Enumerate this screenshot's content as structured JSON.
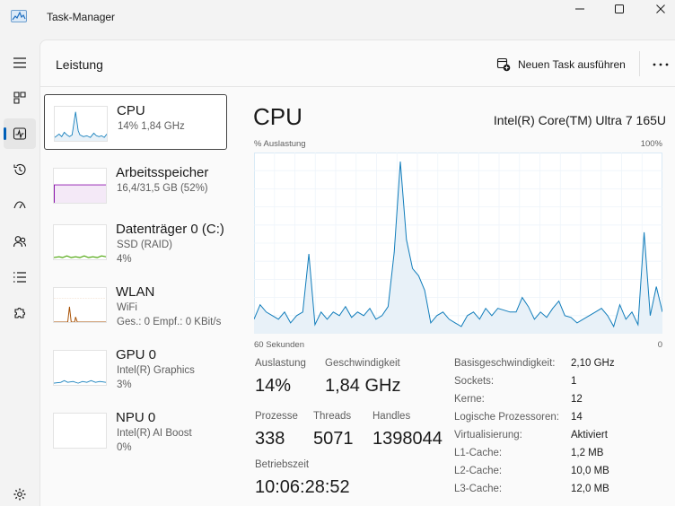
{
  "app": {
    "title": "Task-Manager"
  },
  "header": {
    "title": "Leistung",
    "new_task_label": "Neuen Task ausführen"
  },
  "perf_items": [
    {
      "name": "CPU",
      "sub": "14%  1,84 GHz",
      "color": "#117dbb"
    },
    {
      "name": "Arbeitsspeicher",
      "sub": "16,4/31,5 GB (52%)",
      "color": "#8b12ae"
    },
    {
      "name": "Datenträger 0 (C:)",
      "sub1": "SSD (RAID)",
      "sub2": "4%",
      "color": "#4da60c"
    },
    {
      "name": "WLAN",
      "sub1": "WiFi",
      "sub2": "Ges.: 0  Empf.: 0 KBit/s",
      "color": "#a74f01"
    },
    {
      "name": "GPU 0",
      "sub1": "Intel(R) Graphics",
      "sub2": "3%",
      "color": "#117dbb"
    },
    {
      "name": "NPU 0",
      "sub1": "Intel(R) AI Boost",
      "sub2": "0%",
      "color": "#117dbb"
    }
  ],
  "detail": {
    "title": "CPU",
    "model": "Intel(R) Core(TM) Ultra 7 165U",
    "graph_ylabel": "% Auslastung",
    "graph_ymax": "100%",
    "graph_xstart": "60 Sekunden",
    "graph_xend": "0",
    "graph_color": "#117dbb",
    "stats": {
      "auslastung_label": "Auslastung",
      "auslastung": "14%",
      "speed_label": "Geschwindigkeit",
      "speed": "1,84 GHz",
      "prozesse_label": "Prozesse",
      "prozesse": "338",
      "threads_label": "Threads",
      "threads": "5071",
      "handles_label": "Handles",
      "handles": "1398044",
      "uptime_label": "Betriebszeit",
      "uptime": "10:06:28:52"
    },
    "info": [
      {
        "label": "Basisgeschwindigkeit:",
        "value": "2,10 GHz"
      },
      {
        "label": "Sockets:",
        "value": "1"
      },
      {
        "label": "Kerne:",
        "value": "12"
      },
      {
        "label": "Logische Prozessoren:",
        "value": "14"
      },
      {
        "label": "Virtualisierung:",
        "value": "Aktiviert"
      },
      {
        "label": "L1-Cache:",
        "value": "1,2 MB"
      },
      {
        "label": "L2-Cache:",
        "value": "10,0 MB"
      },
      {
        "label": "L3-Cache:",
        "value": "12,0 MB"
      }
    ]
  },
  "cpu_history": [
    8,
    16,
    12,
    10,
    8,
    12,
    6,
    10,
    12,
    44,
    5,
    12,
    8,
    12,
    10,
    15,
    9,
    12,
    10,
    14,
    8,
    10,
    15,
    45,
    95,
    52,
    36,
    32,
    24,
    6,
    10,
    12,
    8,
    6,
    4,
    10,
    12,
    8,
    14,
    10,
    14,
    13,
    12,
    12,
    20,
    15,
    8,
    12,
    9,
    14,
    18,
    10,
    9,
    6,
    8,
    10,
    12,
    14,
    10,
    4,
    16,
    8,
    12,
    5,
    56,
    10,
    26,
    12
  ]
}
